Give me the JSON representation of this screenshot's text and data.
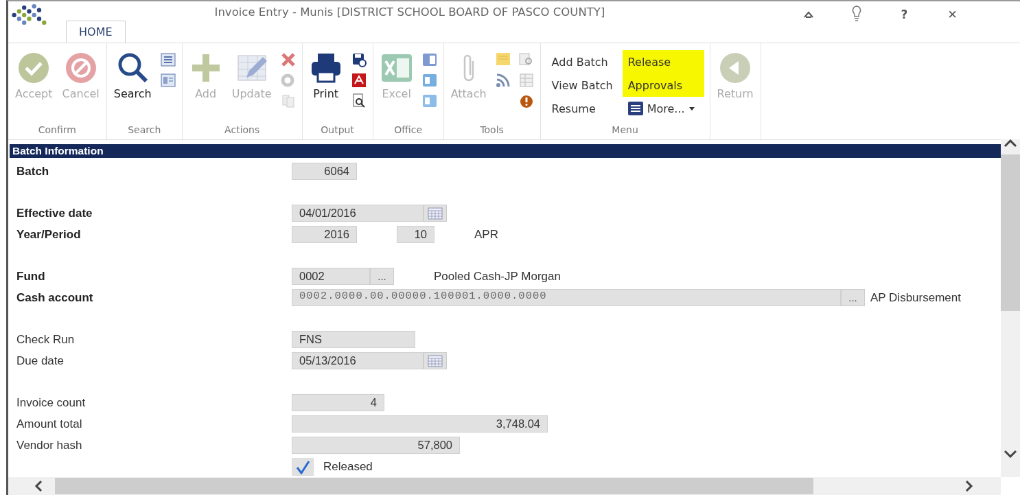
{
  "window": {
    "title": "Invoice Entry - Munis [DISTRICT SCHOOL BOARD OF PASCO COUNTY]",
    "help": "?",
    "close": "✕"
  },
  "tabs": [
    {
      "label": "HOME",
      "selected": true
    }
  ],
  "ribbon": {
    "groups": [
      {
        "label": "Confirm",
        "items": [
          {
            "kind": "large",
            "label": "Accept",
            "disabled": true
          },
          {
            "kind": "large",
            "label": "Cancel",
            "disabled": true
          }
        ]
      },
      {
        "label": "Search",
        "items": [
          {
            "kind": "large",
            "label": "Search",
            "disabled": false
          }
        ]
      },
      {
        "label": "Actions",
        "items": [
          {
            "kind": "large",
            "label": "Add",
            "disabled": true
          },
          {
            "kind": "large",
            "label": "Update",
            "disabled": true
          }
        ]
      },
      {
        "label": "Output",
        "items": [
          {
            "kind": "large",
            "label": "Print",
            "disabled": false
          }
        ]
      },
      {
        "label": "Office",
        "items": [
          {
            "kind": "large",
            "label": "Excel",
            "disabled": true
          }
        ]
      },
      {
        "label": "Tools",
        "items": [
          {
            "kind": "large",
            "label": "Attach",
            "disabled": true
          }
        ]
      },
      {
        "label": "Menu",
        "items": [
          {
            "kind": "link",
            "label": "Add Batch",
            "highlighted": false
          },
          {
            "kind": "link",
            "label": "View Batch",
            "highlighted": false
          },
          {
            "kind": "link",
            "label": "Resume",
            "highlighted": false
          },
          {
            "kind": "link",
            "label": "Release",
            "highlighted": true
          },
          {
            "kind": "link",
            "label": "Approvals",
            "highlighted": true
          },
          {
            "kind": "more",
            "label": "More...",
            "highlighted": false
          }
        ]
      },
      {
        "items": [
          {
            "kind": "large",
            "label": "Return",
            "disabled": true
          }
        ]
      }
    ]
  },
  "section": {
    "title": "Batch Information",
    "groups": [
      [
        {
          "label": "Batch",
          "required": true,
          "fields": [
            {
              "kind": "id",
              "value": "6064"
            }
          ]
        }
      ],
      [
        {
          "label": "Effective date",
          "required": true,
          "fields": [
            {
              "kind": "date",
              "value": "04/01/2016"
            }
          ]
        },
        {
          "label": "Year/Period",
          "required": true,
          "fields": [
            {
              "kind": "id",
              "value": "2016"
            },
            {
              "kind": "period",
              "value": "10"
            },
            {
              "kind": "text",
              "value": "APR"
            }
          ]
        }
      ],
      [
        {
          "label": "Fund",
          "required": true,
          "fields": [
            {
              "kind": "lookup",
              "value": "0002",
              "button": "..."
            },
            {
              "kind": "text",
              "value": "Pooled Cash-JP Morgan"
            }
          ]
        },
        {
          "label": "Cash account",
          "required": true,
          "fields": [
            {
              "kind": "account",
              "value": "0002.0000.00.00000.100001.0000.0000",
              "button": "...",
              "caption": "AP Disbursement"
            }
          ]
        }
      ],
      [
        {
          "label": "Check Run",
          "required": false,
          "fields": [
            {
              "kind": "code",
              "value": "FNS"
            }
          ]
        },
        {
          "label": "Due date",
          "required": false,
          "fields": [
            {
              "kind": "date",
              "value": "05/13/2016"
            }
          ]
        }
      ],
      [
        {
          "label": "Invoice count",
          "required": false,
          "fields": [
            {
              "kind": "count",
              "value": "4"
            }
          ]
        },
        {
          "label": "Amount total",
          "required": false,
          "fields": [
            {
              "kind": "amount",
              "value": "3,748.04"
            }
          ]
        },
        {
          "label": "Vendor hash",
          "required": false,
          "fields": [
            {
              "kind": "hash",
              "value": "57,800"
            }
          ]
        },
        {
          "fields": [
            {
              "kind": "checkbox",
              "label": "Released",
              "checked": true
            }
          ]
        }
      ]
    ]
  }
}
